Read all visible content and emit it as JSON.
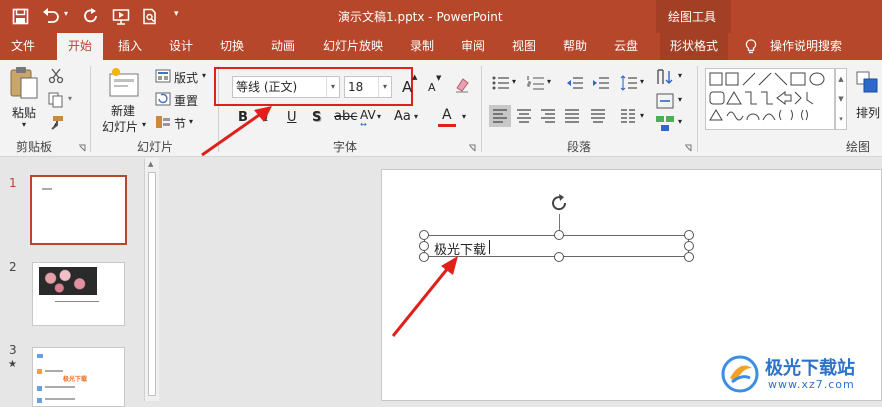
{
  "window": {
    "title": "演示文稿1.pptx  -  PowerPoint",
    "context_label": "绘图工具",
    "customize_arrow": "▾"
  },
  "tabs": [
    {
      "label": "文件"
    },
    {
      "label": "开始"
    },
    {
      "label": "插入"
    },
    {
      "label": "设计"
    },
    {
      "label": "切换"
    },
    {
      "label": "动画"
    },
    {
      "label": "幻灯片放映"
    },
    {
      "label": "录制"
    },
    {
      "label": "审阅"
    },
    {
      "label": "视图"
    },
    {
      "label": "帮助"
    },
    {
      "label": "云盘"
    },
    {
      "label": "形状格式"
    },
    {
      "label": "操作说明搜索"
    }
  ],
  "clipboard": {
    "paste_label": "粘贴",
    "group_label": "剪贴板"
  },
  "slides_group": {
    "new_slide_label_1": "新建",
    "new_slide_label_2": "幻灯片",
    "layout_label": "版式",
    "reset_label": "重置",
    "section_label": "节",
    "group_label": "幻灯片"
  },
  "font": {
    "family_value": "等线 (正文)",
    "size_value": "18",
    "group_label": "字体",
    "bold": "B",
    "italic": "I",
    "underline": "U",
    "shadow": "S",
    "spacing": "AV",
    "case": "Aa",
    "color_a": "A",
    "grow": "A",
    "shrink": "A"
  },
  "paragraph": {
    "group_label": "段落"
  },
  "drawing": {
    "arrange_label": "排列",
    "group_label": "绘图"
  },
  "thumbnails": [
    {
      "number": "1",
      "star": ""
    },
    {
      "number": "2",
      "star": ""
    },
    {
      "number": "3",
      "star": "★"
    }
  ],
  "thumb3": {
    "highlight": "极光下载"
  },
  "textbox": {
    "text": "极光下载"
  },
  "watermark": {
    "title": "极光下载站",
    "url": "www.xz7.com"
  },
  "colors": {
    "accent": "#b7472a",
    "arrow": "#e0201b",
    "highlight_box": "#e0201b"
  }
}
